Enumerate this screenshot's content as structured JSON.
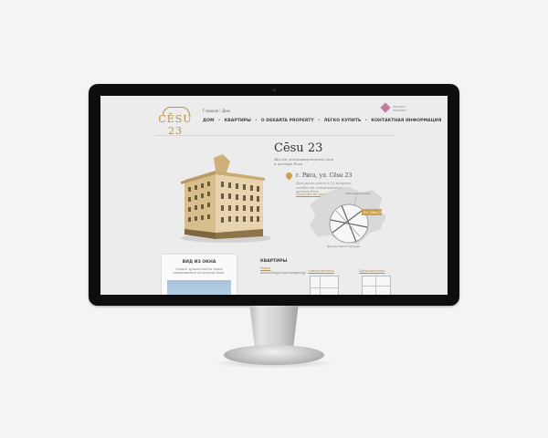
{
  "site": {
    "logo_text": "CĒSU 23",
    "breadcrumb_root": "Главная",
    "breadcrumb_current": "Дом",
    "partner_name": "DEKARTA PROPERTY",
    "nav": [
      "ДОМ",
      "КВАРТИРЫ",
      "O DEKARTA PROPERTY",
      "ЛЕГКО КУПИТЬ",
      "КОНТАКТНАЯ ИНФОРМАЦИЯ"
    ],
    "nav_separator": "•"
  },
  "hero": {
    "title": "Cēsu 23",
    "subtitle": "Жилой многоквартирный дом в центре Риги",
    "address": "г. Рига, ул. Cēsu 23",
    "address_note": "Дом расположен в 15 минутах ходьбы от исторического центра Риги",
    "map_link": "Показать на карте"
  },
  "map": {
    "district_label": "Пригородный район",
    "marker_label": "Ул. Cēsu 23",
    "church_label": "Церковь Святой Гертруды"
  },
  "view_card": {
    "title": "ВИД ИЗ ОКНА",
    "text": "Самый лучший вид на город открывается из верхних окон."
  },
  "apartments": {
    "title": "КВАРТИРЫ",
    "link": "Найти",
    "note": "подходящую вам квартиру",
    "plans": [
      "Однокомнатные",
      "Двухкомнатные"
    ]
  },
  "colors": {
    "accent": "#b8924a",
    "bezel": "#0e0e0e",
    "screen_bg": "#ececec"
  }
}
